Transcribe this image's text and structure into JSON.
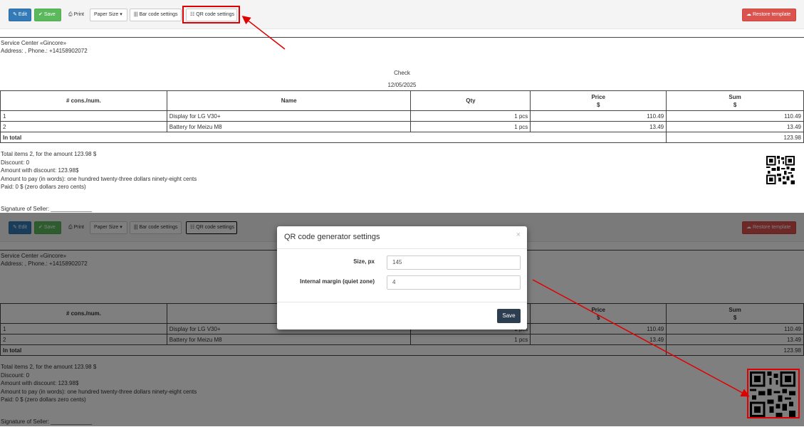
{
  "toolbar": {
    "edit_label": "Edit",
    "save_label": "Save",
    "print_label": "Print",
    "paper_size_label": "Paper Size",
    "bar_code_label": "Bar code settings",
    "qr_code_label": "QR code settings",
    "restore_label": "Restore template"
  },
  "document": {
    "org_name": "Service Center «Gincore»",
    "org_contact": "Address: , Phone.: +14158902072",
    "title": "Check",
    "date": "12/05/2025",
    "headers": {
      "num": "# cons./num.",
      "name": "Name",
      "qty": "Qty",
      "price": "Price",
      "price_unit": "$",
      "sum": "Sum",
      "sum_unit": "$"
    },
    "rows": [
      {
        "num": "1",
        "name": "Display for LG V30+",
        "qty": "1 pcs",
        "price": "110.49",
        "sum": "110.49"
      },
      {
        "num": "2",
        "name": "Battery for Meizu M8",
        "qty": "1 pcs",
        "price": "13.49",
        "sum": "13.49"
      }
    ],
    "total_label": "In total",
    "total_value": "123.98",
    "summary": [
      "Total items 2, for the amount 123.98 $",
      "Discount: 0",
      "Amount with discount: 123.98$",
      "Amount to pay (in words): one hundred twenty-three dollars ninety-eight cents",
      "Paid: 0 $ (zero dollars zero cents)"
    ],
    "signature": "Signature of Seller: _____________"
  },
  "modal": {
    "title": "QR code generator settings",
    "close": "×",
    "size_label": "Size, px",
    "size_value": "145",
    "margin_label": "Internal margin (quiet zone)",
    "margin_value": "4",
    "save_label": "Save"
  },
  "colors": {
    "primary": "#337ab7",
    "success": "#5cb85c",
    "danger": "#d9534f",
    "modal_save": "#2c3e50",
    "annotation": "#e00000"
  }
}
